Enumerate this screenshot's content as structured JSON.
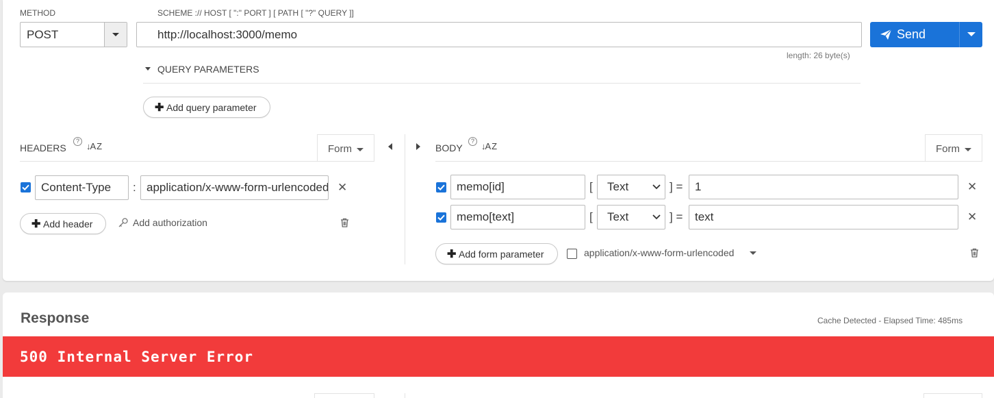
{
  "request": {
    "method_label": "METHOD",
    "method_value": "POST",
    "url_hint": "SCHEME :// HOST [ \":\" PORT ] [ PATH [ \"?\" QUERY ]]",
    "url_value": "http://localhost:3000/memo",
    "url_length": "length: 26 byte(s)",
    "send_label": "Send"
  },
  "query": {
    "title": "QUERY PARAMETERS",
    "add_label": "Add query parameter"
  },
  "headers": {
    "title": "HEADERS",
    "help": "?",
    "sort": "↓A Z",
    "mode": "Form",
    "rows": [
      {
        "checked": true,
        "name": "Content-Type",
        "separator": ":",
        "value": "application/x-www-form-urlencoded"
      }
    ],
    "add_label": "Add header",
    "auth_label": "Add authorization"
  },
  "body": {
    "title": "BODY",
    "help": "?",
    "mode": "Form",
    "rows": [
      {
        "checked": true,
        "name": "memo[id]",
        "open_bracket": "[",
        "type": "Text",
        "close_eq": "] =",
        "value": "1"
      },
      {
        "checked": true,
        "name": "memo[text]",
        "open_bracket": "[",
        "type": "Text",
        "close_eq": "] =",
        "value": "text"
      }
    ],
    "add_label": "Add form parameter",
    "content_type": "application/x-www-form-urlencoded"
  },
  "response": {
    "title": "Response",
    "meta": "Cache Detected - Elapsed Time: 485ms",
    "status": "500 Internal Server Error"
  },
  "icons": {
    "remove": "✕",
    "plus": "✚",
    "trash": "🗑"
  },
  "colors": {
    "accent": "#1a73d9",
    "error": "#f23b3b"
  }
}
